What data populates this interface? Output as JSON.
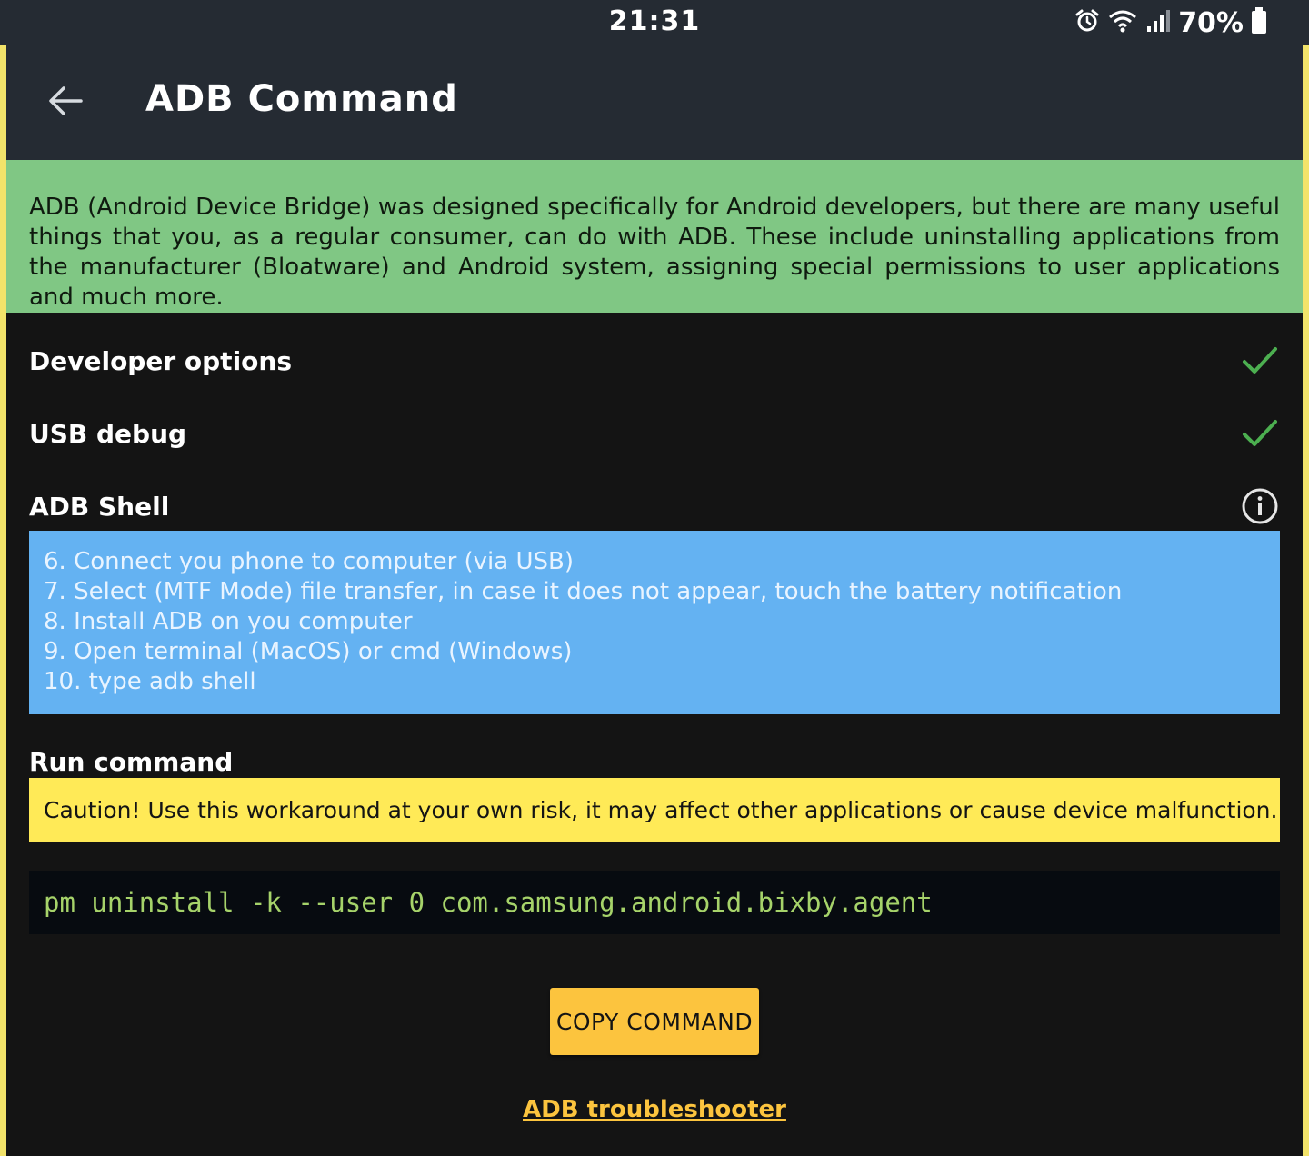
{
  "status_bar": {
    "time": "21:31",
    "battery": "70%",
    "icons": [
      "alarm-icon",
      "wifi-icon",
      "signal-icon",
      "battery-icon"
    ]
  },
  "app_bar": {
    "back_icon": "arrow-left-icon",
    "title": "ADB Command"
  },
  "intro": {
    "text": "ADB (Android Device Bridge) was designed specifically for Android developers, but there are many useful things that you, as a regular consumer, can do with ADB. These include uninstalling applications from the manufacturer (Bloatware) and Android system, assigning special permissions to user applications and much more."
  },
  "checklist": [
    {
      "label": "Developer options",
      "icon": "check-icon",
      "status": "done"
    },
    {
      "label": "USB debug",
      "icon": "check-icon",
      "status": "done"
    },
    {
      "label": "ADB Shell",
      "icon": "info-icon",
      "status": "info"
    }
  ],
  "steps": [
    "6. Connect you phone to computer (via USB)",
    "7. Select (MTF Mode) file transfer, in case it does not appear, touch the battery notification",
    "8. Install ADB on you computer",
    "9. Open terminal (MacOS) or cmd (Windows)",
    "10. type adb shell"
  ],
  "run_command": {
    "label": "Run command",
    "caution": "Caution! Use this workaround at your own risk, it may affect other applications or cause device malfunction.",
    "command": "pm uninstall -k --user 0 com.samsung.android.bixby.agent",
    "copy_button": "COPY COMMAND"
  },
  "troubleshooter_link": "ADB troubleshooter",
  "colors": {
    "app_bar": "#252b33",
    "background": "#141414",
    "intro_bg": "#80c784",
    "steps_bg": "#64b2f2",
    "caution_bg": "#ffea57",
    "command_bg": "#070b10",
    "command_text": "#a6d36a",
    "accent": "#fcc43e",
    "check": "#4caf50"
  }
}
